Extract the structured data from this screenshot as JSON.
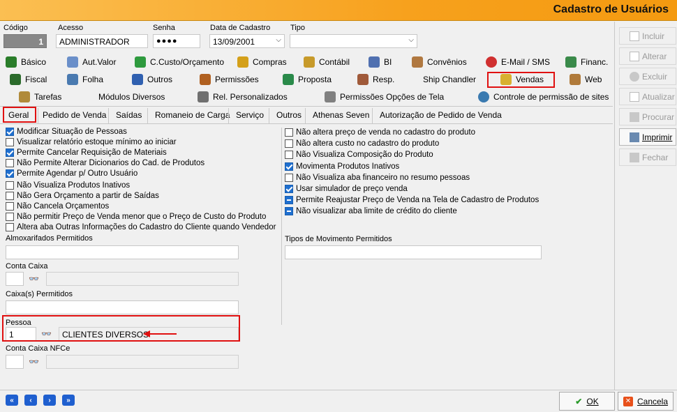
{
  "window": {
    "title": "Cadastro de Usuários"
  },
  "header": {
    "codigo_label": "Código",
    "codigo_value": "1",
    "acesso_label": "Acesso",
    "acesso_value": "ADMINISTRADOR",
    "senha_label": "Senha",
    "senha_value": "●●●●",
    "data_label": "Data de Cadastro",
    "data_value": "13/09/2001",
    "tipo_label": "Tipo",
    "tipo_value": ""
  },
  "tabs": {
    "row1": [
      "Básico",
      "Aut.Valor",
      "C.Custo/Orçamento",
      "Compras",
      "Contábil",
      "BI",
      "Convênios",
      "E-Mail / SMS",
      "Financ."
    ],
    "row2": [
      "Fiscal",
      "Folha",
      "Outros",
      "Permissões",
      "Proposta",
      "Resp.",
      "Ship Chandler",
      "Vendas",
      "Web"
    ],
    "row3": [
      "Tarefas",
      "Módulos Diversos",
      "Rel. Personalizados",
      "Permissões Opções de Tela",
      "Controle de permissão de sites"
    ]
  },
  "subtabs": [
    "Geral",
    "Pedido de Venda",
    "Saídas",
    "Romaneio de Carga",
    "Serviço",
    "Outros",
    "Athenas Seven",
    "Autorização de Pedido de Venda"
  ],
  "left_checks": [
    {
      "label": "Modificar Situação de Pessoas",
      "state": "on"
    },
    {
      "label": "Visualizar relatório estoque mínimo ao iniciar",
      "state": "off"
    },
    {
      "label": "Permite Cancelar Requisição de Materiais",
      "state": "on"
    },
    {
      "label": "Não Permite Alterar Dicionarios do Cad. de Produtos",
      "state": "off"
    },
    {
      "label": "Permite Agendar p/ Outro Usuário",
      "state": "on"
    },
    {
      "label": "Não Visualiza Produtos Inativos",
      "state": "off"
    },
    {
      "label": "Não Gera Orçamento a partir de Saídas",
      "state": "off"
    },
    {
      "label": "Não Cancela Orçamentos",
      "state": "off"
    },
    {
      "label": "Não permitir Preço de Venda menor que o Preço de Custo do Produto",
      "state": "off"
    },
    {
      "label": "Altera aba Outras Informações do Cadastro do Cliente quando Vendedor",
      "state": "off"
    }
  ],
  "right_checks": [
    {
      "label": "Não altera preço de venda no cadastro do produto",
      "state": "off"
    },
    {
      "label": "Não altera custo no cadastro do produto",
      "state": "off"
    },
    {
      "label": "Não Visualiza Composição do Produto",
      "state": "off"
    },
    {
      "label": "Movimenta Produtos Inativos",
      "state": "on"
    },
    {
      "label": "Não Visualiza aba financeiro no resumo pessoas",
      "state": "off"
    },
    {
      "label": "Usar simulador de preço venda",
      "state": "on"
    },
    {
      "label": "Permite Reajustar Preço de Venda na Tela de Cadastro de Produtos",
      "state": "ind"
    },
    {
      "label": "Não visualizar aba limite de crédito do cliente",
      "state": "ind"
    }
  ],
  "fields": {
    "almox_label": "Almoxarifados Permitidos",
    "conta_caixa_label": "Conta Caixa",
    "caixas_label": "Caixa(s) Permitidos",
    "pessoa_label": "Pessoa",
    "pessoa_code": "1",
    "pessoa_name": "CLIENTES DIVERSOS",
    "conta_nfce_label": "Conta Caixa NFCe",
    "tipos_mov_label": "Tipos de Movimento Permitidos"
  },
  "side_buttons": [
    "Incluir",
    "Alterar",
    "Excluir",
    "Atualizar",
    "Procurar",
    "Imprimir",
    "Fechar"
  ],
  "footer": {
    "ok_label": "OK",
    "cancel_label": "Cancela"
  }
}
